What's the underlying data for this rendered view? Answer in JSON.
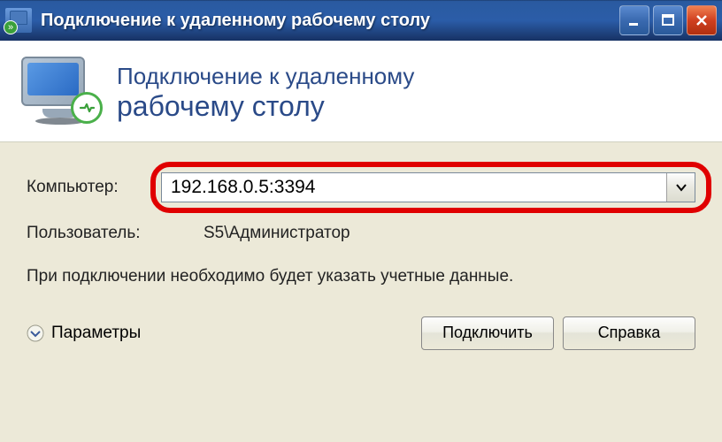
{
  "window": {
    "title": "Подключение к удаленному рабочему столу"
  },
  "header": {
    "line1": "Подключение к удаленному",
    "line2": "рабочему столу"
  },
  "fields": {
    "computer_label": "Компьютер:",
    "computer_value": "192.168.0.5:3394",
    "user_label": "Пользователь:",
    "user_value": "S5\\Администратор"
  },
  "info_text": "При подключении необходимо будет указать учетные данные.",
  "footer": {
    "options_label": "Параметры",
    "connect_label": "Подключить",
    "help_label": "Справка"
  }
}
